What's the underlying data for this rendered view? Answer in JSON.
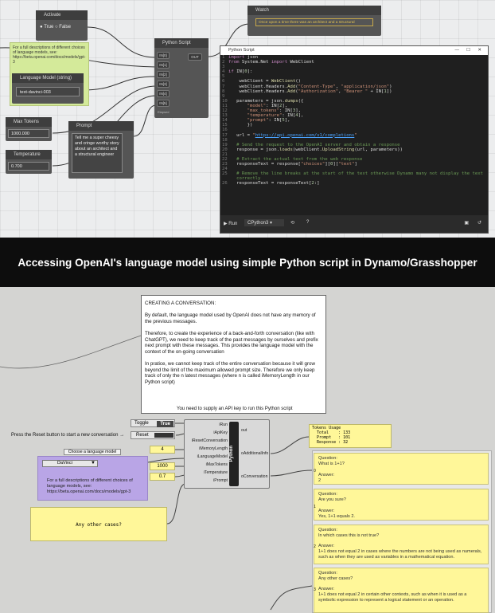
{
  "activate": {
    "title": "Activate",
    "true": "True",
    "false": "False"
  },
  "note_top": {
    "text": "For a full descriptions of different choices of language models, see: https://beta.openai.com/docs/models/gpt-3"
  },
  "language_model": {
    "title": "Language Model (string)",
    "value": "text-davinci-003"
  },
  "max_tokens": {
    "title": "Max Tokens",
    "value": "1000.000"
  },
  "temperature": {
    "title": "Temperature",
    "value": "0.700"
  },
  "prompt": {
    "title": "Prompt",
    "value": "Tell me a super cheesy and cringe worthy story about an architect and a structural engineer"
  },
  "python_node": {
    "title": "Python Script",
    "inputs": [
      "IN[0]",
      "IN[1]",
      "IN[2]",
      "IN[3]",
      "IN[4]",
      "IN[5]"
    ],
    "output": "OUT",
    "lacing": "Elapsed"
  },
  "watch": {
    "title": "Watch",
    "value": "Once upon a time there was an architect and a structural"
  },
  "editor": {
    "title": "Python Script",
    "run": "Run",
    "engine": "CPython3",
    "code": [
      "import json",
      "from System.Net import WebClient",
      "",
      "if IN[0]:",
      "",
      "    webClient = WebClient()",
      "    webClient.Headers.Add(\"Content-Type\", \"application/json\")",
      "    webClient.Headers.Add(\"Authorization\", \"Bearer \" + IN[1])",
      "",
      "    parameters = json.dumps({",
      "        \"model\": IN[2],",
      "        \"max_tokens\": IN[3],",
      "        \"temperature\": IN[4],",
      "        \"prompt\": IN[5],",
      "        })",
      "",
      "    url = \"https://api.openai.com/v1/completions\"",
      "",
      "    # Send the request to the OpenAI server and obtain a response",
      "    response = json.loads(webClient.UploadString(url, parameters))",
      "",
      "    # Extract the actual text from the web response",
      "    responseText = response[\"choices\"][0][\"text\"]",
      "",
      "    # Remove the line breaks at the start of the text otherwise Dynamo many not display the text",
      "    correctly",
      "    responseText = responseText[2:]"
    ]
  },
  "banner": "Accessing OpenAI's language model using simple Python script in Dynamo/Grasshopper",
  "panel": {
    "text": "CREATING A CONVERSATION:\n\nBy default, the language model used by OpenAI does not have any memory of the previous messages.\n\nTherefore, to create the experience of a back-and-forth conversation (like with ChatGPT), we need to keep track of the past messages by ourselves and prefix next prompt with these messages. This provides the language model with the context of the on-going conversation\n\nIn pratice, we cannot keep track of the entire conversation because it will grow beyond the limit of the maximum allowed prompt size. Therefore we only keep track of only the n latest messages (where n is called iMemoryLength in our Python script)"
  },
  "api_note": "You need to supply an API key to run this Python script",
  "toggle": {
    "label": "Toggle",
    "value": "True"
  },
  "reset": {
    "hint": "Press the Reset button to start a new conversation →",
    "label": "Reset"
  },
  "memory_value": "4",
  "model_choice": {
    "caption": "Choose a language model",
    "value": "DaVinci",
    "note": "For a full descriptions of different choices of language models, see: https://beta.openai.com/docs/models/gpt-3"
  },
  "tokens_value": "1000",
  "temp_value": "0.7",
  "gh_python": {
    "label": "Python",
    "inputs": [
      "iRun",
      "iApiKey",
      "iResetConversation",
      "iMemoryLength",
      "iLanguageModel",
      "iMaxTokens",
      "iTemperature",
      "iPrompt"
    ],
    "outputs": [
      "out",
      "oAdditionalInfo",
      "oConversation"
    ]
  },
  "tokens_usage": {
    "text": "Tokens Usage\n  Total    : 133\n  Prompt   : 101\n  Response : 32"
  },
  "prompt_panel": "Any other cases?",
  "conversation": [
    {
      "idx": "0",
      "question": "What is 1+1?",
      "answer": "2"
    },
    {
      "idx": "1",
      "question": "Are you sure?",
      "answer": "Yes, 1+1 equals 2."
    },
    {
      "idx": "2",
      "question": "In which cases this is not true?",
      "answer": "1+1 does not equal 2 in cases where the numbers are not being used as numerals, such as when they are used as variables in a mathematical equation."
    },
    {
      "idx": "3",
      "question": "Any other cases?",
      "answer": "1+1 does not equal 2 in certain other contexts, such as when it is used as a symbolic expression to represent a logical statement or an operation."
    }
  ],
  "labels": {
    "question": "Question:",
    "answer": "Answer:"
  }
}
